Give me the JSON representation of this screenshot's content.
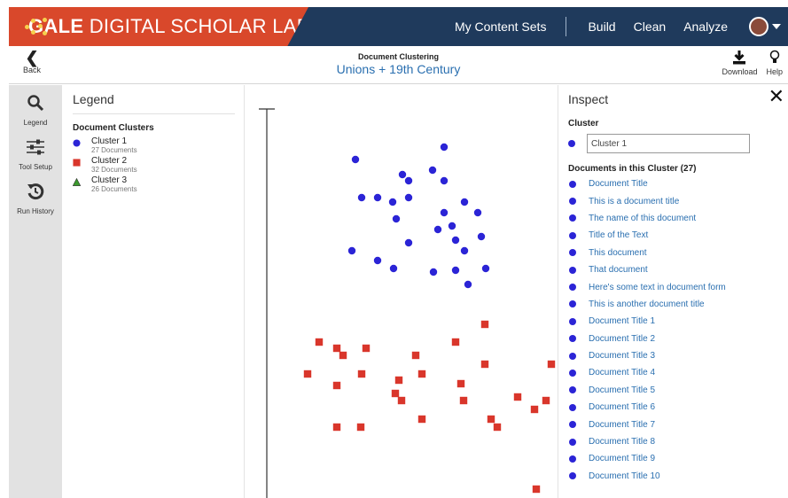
{
  "header": {
    "brand_bold": "GALE",
    "brand_rest": " DIGITAL SCHOLAR LAB",
    "nav": [
      "My Content Sets",
      "Build",
      "Clean",
      "Analyze"
    ],
    "brand_color": "#d9482b",
    "bar_color": "#1f3a5c"
  },
  "titlebar": {
    "back": "Back",
    "tool_name": "Document Clustering",
    "content_set": "Unions + 19th Century",
    "download": "Download",
    "help": "Help"
  },
  "rail": {
    "items": [
      {
        "label": "Legend",
        "icon": "legend-magnifier-icon"
      },
      {
        "label": "Tool Setup",
        "icon": "sliders-icon"
      },
      {
        "label": "Run History",
        "icon": "history-icon"
      }
    ]
  },
  "legend": {
    "title": "Legend",
    "section": "Document Clusters",
    "clusters": [
      {
        "name": "Cluster 1",
        "count": "27 Documents",
        "shape": "circle",
        "color": "#2b24d6"
      },
      {
        "name": "Cluster 2",
        "count": "32 Documents",
        "shape": "square",
        "color": "#d9362b"
      },
      {
        "name": "Cluster 3",
        "count": "26 Documents",
        "shape": "triangle",
        "color": "#3c9a2e"
      }
    ]
  },
  "inspect": {
    "title": "Inspect",
    "cluster_label": "Cluster",
    "cluster_value": "Cluster 1",
    "documents_heading": "Documents in this Cluster (27)",
    "documents": [
      "Document Title",
      "This is a document title",
      "The name of this document",
      "Title of the Text",
      "This document",
      "That document",
      "Here's some text in document form",
      "This is another document title",
      "Document Title 1",
      "Document Title 2",
      "Document Title 3",
      "Document Title 4",
      "Document Title 5",
      "Document Title 6",
      "Document Title 7",
      "Document Title 8",
      "Document Title 9",
      "Document Title 10"
    ]
  },
  "scatter": {
    "cluster1_points": [
      [
        224,
        70
      ],
      [
        124,
        84
      ],
      [
        211,
        96
      ],
      [
        177,
        101
      ],
      [
        184,
        108
      ],
      [
        224,
        108
      ],
      [
        131,
        127
      ],
      [
        149,
        127
      ],
      [
        166,
        132
      ],
      [
        184,
        127
      ],
      [
        247,
        132
      ],
      [
        224,
        144
      ],
      [
        262,
        144
      ],
      [
        170,
        151
      ],
      [
        233,
        159
      ],
      [
        217,
        163
      ],
      [
        266,
        171
      ],
      [
        184,
        178
      ],
      [
        237,
        175
      ],
      [
        247,
        187
      ],
      [
        120,
        187
      ],
      [
        149,
        198
      ],
      [
        167,
        207
      ],
      [
        212,
        211
      ],
      [
        237,
        209
      ],
      [
        271,
        207
      ],
      [
        251,
        225
      ]
    ],
    "cluster2_points": [
      [
        270,
        270
      ],
      [
        83,
        290
      ],
      [
        103,
        297
      ],
      [
        110,
        305
      ],
      [
        136,
        297
      ],
      [
        237,
        290
      ],
      [
        192,
        305
      ],
      [
        270,
        315
      ],
      [
        70,
        326
      ],
      [
        131,
        326
      ],
      [
        199,
        326
      ],
      [
        103,
        339
      ],
      [
        173,
        333
      ],
      [
        243,
        337
      ],
      [
        169,
        348
      ],
      [
        176,
        356
      ],
      [
        246,
        356
      ],
      [
        307,
        352
      ],
      [
        339,
        356
      ],
      [
        326,
        366
      ],
      [
        199,
        377
      ],
      [
        277,
        377
      ],
      [
        284,
        386
      ],
      [
        103,
        386
      ],
      [
        130,
        386
      ],
      [
        328,
        456
      ],
      [
        345,
        315
      ]
    ]
  }
}
